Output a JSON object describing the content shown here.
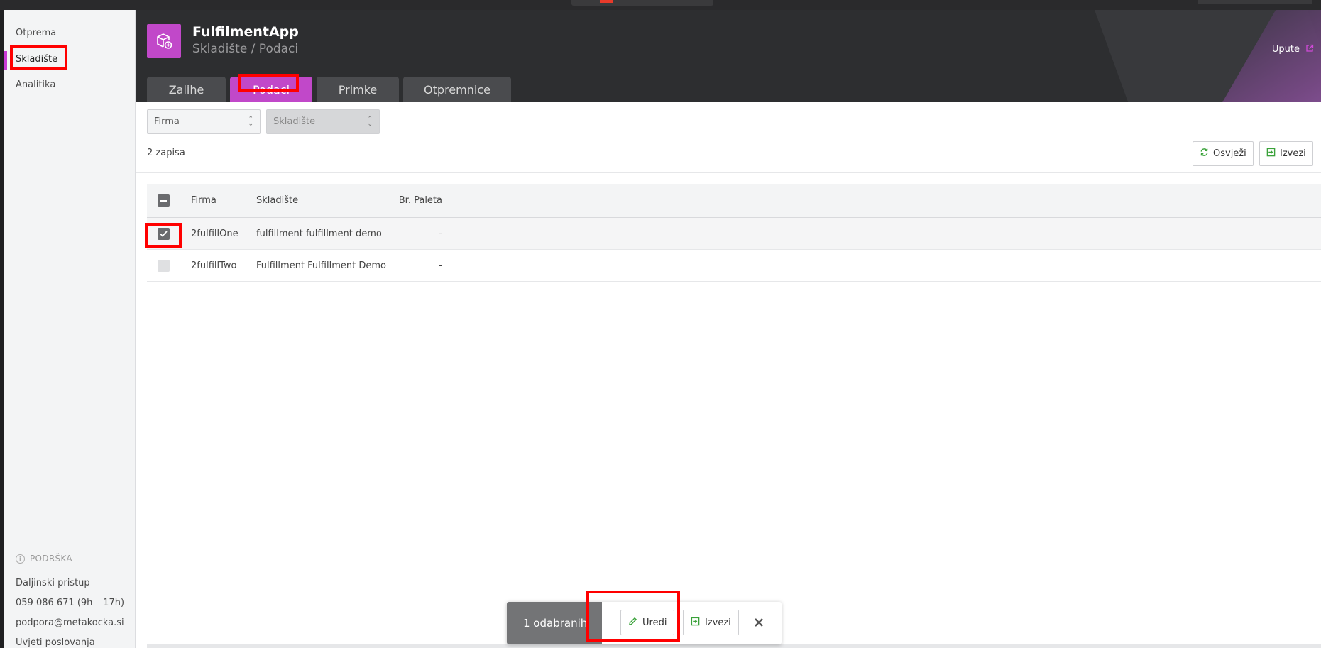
{
  "sidebar": {
    "items": [
      {
        "label": "Otprema"
      },
      {
        "label": "Skladište"
      },
      {
        "label": "Analitika"
      }
    ],
    "support_title": "PODRŠKA",
    "support_items": [
      {
        "label": "Daljinski pristup"
      },
      {
        "label": "059 086 671 (9h – 17h)"
      },
      {
        "label": "podpora@metakocka.si"
      },
      {
        "label": "Uvjeti poslovanja"
      }
    ]
  },
  "header": {
    "title": "FulfilmentApp",
    "subtitle": "Skladište / Podaci",
    "help_label": "Upute",
    "tabs": [
      {
        "label": "Zalihe"
      },
      {
        "label": "Podaci"
      },
      {
        "label": "Primke"
      },
      {
        "label": "Otpremnice"
      }
    ],
    "active_tab": "Podaci",
    "accent_color": "#c148c9"
  },
  "filters": {
    "company_placeholder": "Firma",
    "warehouse_placeholder": "Skladište"
  },
  "toolbar": {
    "record_count": "2 zapisa",
    "refresh_label": "Osvježi",
    "export_label": "Izvezi"
  },
  "table": {
    "columns": [
      "Firma",
      "Skladište",
      "Br. Paleta"
    ],
    "rows": [
      {
        "company": "2fulfillOne",
        "warehouse": "fulfillment fulfillment demo",
        "pallets": "-",
        "selected": true
      },
      {
        "company": "2fulfillTwo",
        "warehouse": "Fulfillment Fulfillment Demo",
        "pallets": "-",
        "selected": false
      }
    ]
  },
  "selection_bar": {
    "count_label": "1 odabranih",
    "edit_label": "Uredi",
    "export_label": "Izvezi"
  }
}
